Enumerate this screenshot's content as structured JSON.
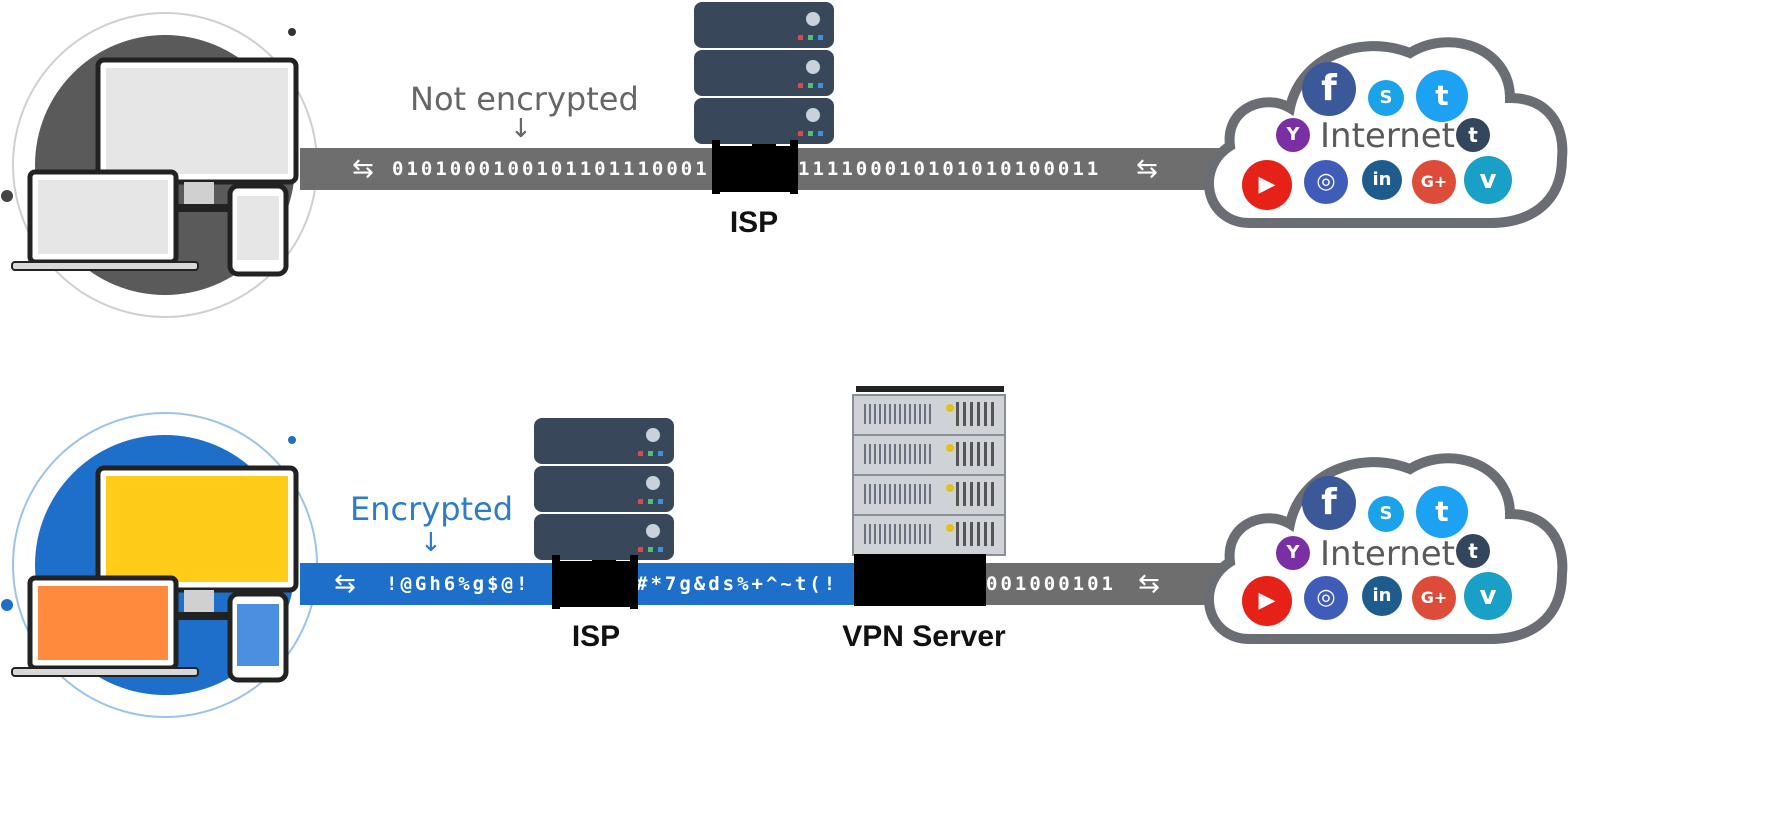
{
  "top": {
    "label": "Not encrypted",
    "bits_left": "0101000100101101110001",
    "bits_right": "111100010101010100011",
    "isp_caption": "ISP"
  },
  "bottom": {
    "label": "Encrypted",
    "bits_left": "!@Gh6%g$@!",
    "bits_mid": "#*7g&ds%+^~t(!",
    "bits_right": "001000101",
    "isp_caption": "ISP",
    "vpn_caption": "VPN Server"
  },
  "cloud": {
    "label": "Internet"
  },
  "social_icons": [
    {
      "name": "facebook-icon",
      "glyph": "f",
      "color": "#3b5998"
    },
    {
      "name": "skype-icon",
      "glyph": "S",
      "color": "#1aa3e8"
    },
    {
      "name": "twitter-icon",
      "glyph": "t",
      "color": "#1da1f2"
    },
    {
      "name": "yahoo-icon",
      "glyph": "Y",
      "color": "#7b2fa5"
    },
    {
      "name": "tumblr-icon",
      "glyph": "t",
      "color": "#34465d"
    },
    {
      "name": "youtube-icon",
      "glyph": "▶",
      "color": "#e62117"
    },
    {
      "name": "instagram-icon",
      "glyph": "◎",
      "color": "#3f5cb8"
    },
    {
      "name": "linkedin-icon",
      "glyph": "in",
      "color": "#1e5c8e"
    },
    {
      "name": "googleplus-icon",
      "glyph": "G+",
      "color": "#dd4b39"
    },
    {
      "name": "vimeo-icon",
      "glyph": "v",
      "color": "#1a9fc7"
    }
  ],
  "colors": {
    "pipe_gray": "#6e6e6e",
    "pipe_blue": "#1d6fc9",
    "server_dark": "#38475a",
    "accent_blue": "#2c7cc9",
    "screen_yellow": "#ffcc1a",
    "screen_orange": "#ff8a3d"
  }
}
